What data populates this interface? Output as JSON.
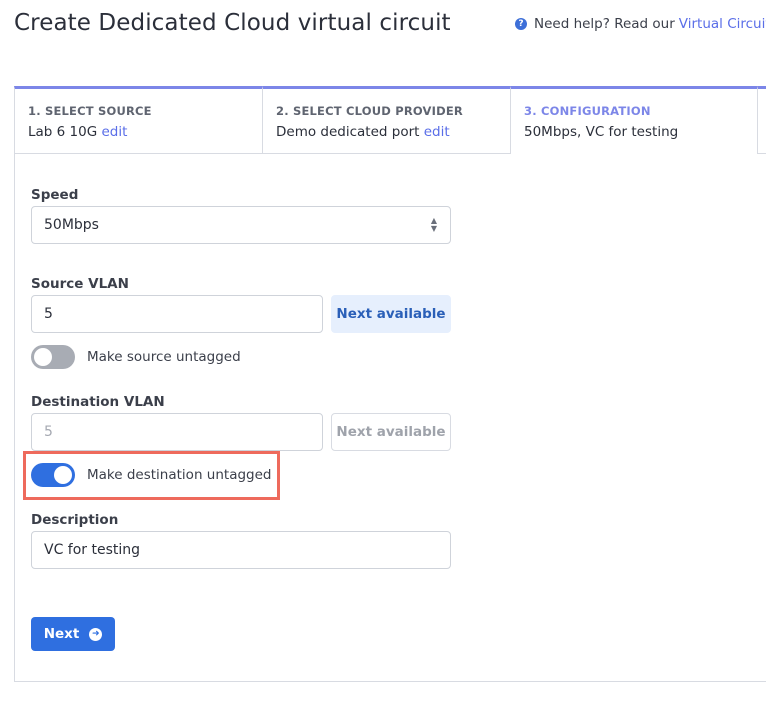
{
  "page": {
    "title": "Create Dedicated Cloud virtual circuit",
    "help_prefix": "Need help? Read our",
    "help_link": "Virtual Circuits",
    "help_icon": "question-circle-icon"
  },
  "steps": [
    {
      "label": "1. SELECT SOURCE",
      "value": "Lab 6 10G",
      "edit": "edit"
    },
    {
      "label": "2. SELECT CLOUD PROVIDER",
      "value": "Demo dedicated port",
      "edit": "edit"
    },
    {
      "label": "3. CONFIGURATION",
      "value": "50Mbps, VC for testing"
    }
  ],
  "form": {
    "speed": {
      "label": "Speed",
      "value": "50Mbps"
    },
    "source_vlan": {
      "label": "Source VLAN",
      "value": "5",
      "next_available": "Next available",
      "toggle_label": "Make source untagged",
      "toggle_on": false
    },
    "destination_vlan": {
      "label": "Destination VLAN",
      "value": "5",
      "next_available": "Next available",
      "toggle_label": "Make destination untagged",
      "toggle_on": true
    },
    "description": {
      "label": "Description",
      "value": "VC for testing"
    },
    "next_button": "Next",
    "next_icon": "arrow-right-circle-icon"
  },
  "colors": {
    "accent": "#2f6fe0",
    "active_step": "#7c86e8",
    "link": "#5a6ee8",
    "highlight": "#ee6a5c"
  }
}
